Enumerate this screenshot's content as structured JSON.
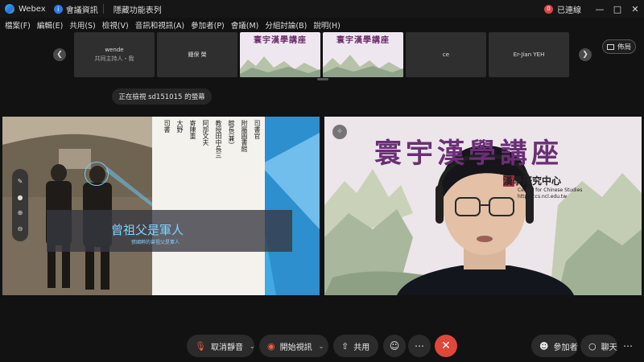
{
  "titlebar": {
    "app_name": "Webex",
    "meeting_info": "會議資訊",
    "hidden_features": "隱藏功能表列",
    "connection_badge": "0",
    "connection_status": "已連線",
    "icons": [
      "webex-logo-icon",
      "info-icon",
      "minimize-icon",
      "restore-icon",
      "close-icon"
    ]
  },
  "menu": {
    "items": [
      "檔案(F)",
      "編輯(E)",
      "共用(S)",
      "檢視(V)",
      "音訊和視訊(A)",
      "參加者(P)",
      "會議(M)",
      "分組討論(B)",
      "說明(H)"
    ]
  },
  "strip": {
    "tiles": [
      {
        "name": "wende",
        "role": "共同主持人・我"
      },
      {
        "name": "鍾保 榮",
        "role": ""
      },
      {
        "name": "寰宇漢學講座",
        "role": ""
      },
      {
        "name": "寰宇漢學講座",
        "role": ""
      },
      {
        "name": "ce",
        "role": ""
      },
      {
        "name": "Er-Jian YEH",
        "role": ""
      }
    ],
    "layout_label": "佈局"
  },
  "share": {
    "viewing_label": "正在檢視 sd151015 的螢幕",
    "caption_main": "曾祖父是軍人",
    "caption_sub": "張國粹的曾祖父是軍人",
    "newspaper_cols": [
      "司書官",
      "附屬圖書館",
      "館長(兼)",
      "教授田中長三",
      "阿部文夫",
      "寄陳重",
      "大野",
      "司書"
    ]
  },
  "video": {
    "title": "寰宇漢學講座",
    "center_name": "漢學研究中心",
    "center_en": "Center for Chinese Studies",
    "url": "http://ccs.ncl.edu.tw"
  },
  "controls": {
    "mute_label": "取消靜音",
    "video_label": "開始視訊",
    "share_label": "共用",
    "participants_label": "參加者",
    "chat_label": "聊天"
  },
  "colors": {
    "background": "#121212",
    "accent_red": "#e0463a",
    "share_blue": "#3fa8e0",
    "title_purple": "#6a2f76"
  }
}
